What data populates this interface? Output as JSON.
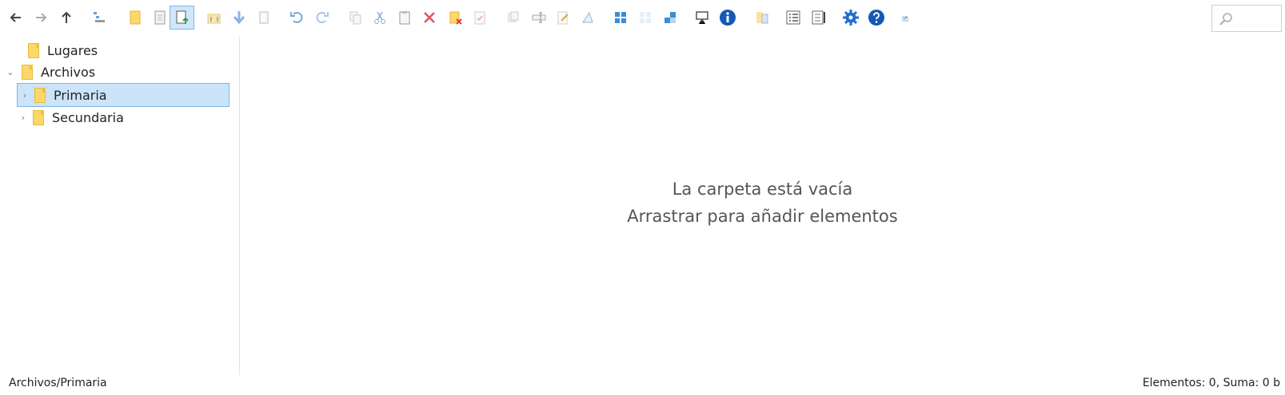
{
  "toolbar": {
    "buttons": [
      {
        "name": "back-icon"
      },
      {
        "name": "forward-icon"
      },
      {
        "name": "up-icon"
      },
      {
        "name": "tree-toggle-icon"
      },
      {
        "name": "new-folder-icon"
      },
      {
        "name": "new-file-icon"
      },
      {
        "name": "upload-icon",
        "active": true
      },
      {
        "name": "open-folder-icon"
      },
      {
        "name": "download-icon"
      },
      {
        "name": "file-icon"
      },
      {
        "name": "undo-icon"
      },
      {
        "name": "redo-icon"
      },
      {
        "name": "copy-icon"
      },
      {
        "name": "cut-icon"
      },
      {
        "name": "paste-icon"
      },
      {
        "name": "delete-icon"
      },
      {
        "name": "delete-folder-icon"
      },
      {
        "name": "select-icon"
      },
      {
        "name": "duplicate-icon"
      },
      {
        "name": "rename-icon"
      },
      {
        "name": "edit-icon"
      },
      {
        "name": "measure-icon"
      },
      {
        "name": "view-large-icon"
      },
      {
        "name": "view-grid-icon"
      },
      {
        "name": "view-small-icon"
      },
      {
        "name": "presentation-icon"
      },
      {
        "name": "info-icon"
      },
      {
        "name": "properties-icon"
      },
      {
        "name": "view-list-icon"
      },
      {
        "name": "view-details-icon"
      },
      {
        "name": "settings-icon"
      },
      {
        "name": "help-icon"
      },
      {
        "name": "expand-icon"
      }
    ],
    "search_placeholder": ""
  },
  "tree": {
    "items": [
      {
        "label": "Lugares",
        "expander": ""
      },
      {
        "label": "Archivos",
        "expander": "⌄"
      },
      {
        "label": "Primaria",
        "expander": "›"
      },
      {
        "label": "Secundaria",
        "expander": "›"
      }
    ]
  },
  "main": {
    "empty_line1": "La carpeta está vacía",
    "empty_line2": "Arrastrar para añadir elementos"
  },
  "status": {
    "path": "Archivos/Primaria",
    "summary": "Elementos: 0, Suma: 0 b"
  },
  "colors": {
    "accent": "#1e6fd0",
    "folder": "#fcd769",
    "selection": "#cce4fa"
  }
}
